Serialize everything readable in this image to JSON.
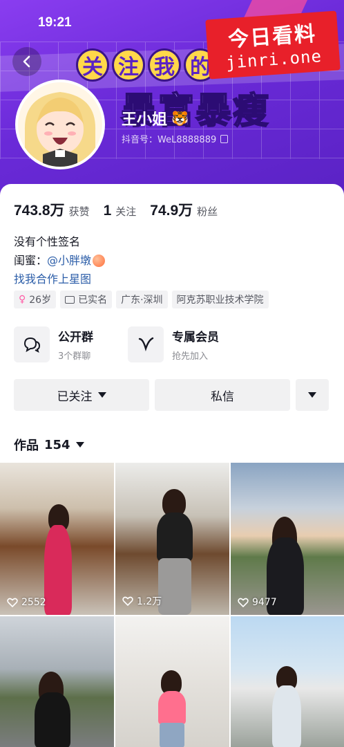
{
  "status_bar": {
    "time": "19:21"
  },
  "banner": {
    "headline_chars": [
      "关",
      "注",
      "我",
      "的"
    ],
    "subtitle": "暴富暴瘦",
    "watermark_top": "今日看料",
    "watermark_bottom": "jinri.one"
  },
  "profile": {
    "name": "王小姐",
    "name_emoji": "🐯",
    "douyin_id": "抖音号：WeL8888889",
    "stats": [
      {
        "value": "743.8万",
        "label": "获赞"
      },
      {
        "value": "1",
        "label": "关注"
      },
      {
        "value": "74.9万",
        "label": "粉丝"
      }
    ],
    "signature": "没有个性签名",
    "bestie_label": "闺蜜：",
    "bestie_mention": "@小胖墩",
    "collab_link": "找我合作上星图",
    "tags": {
      "age": "26岁",
      "verified": "已实名",
      "location": "广东·深圳",
      "school": "阿克苏职业技术学院"
    }
  },
  "features": [
    {
      "title": "公开群",
      "subtitle": "3个群聊",
      "icon": "group-chat-icon"
    },
    {
      "title": "专属会员",
      "subtitle": "抢先加入",
      "icon": "membership-icon"
    }
  ],
  "actions": {
    "follow_label": "已关注",
    "message_label": "私信"
  },
  "works": {
    "label": "作品",
    "count": "154"
  },
  "videos": [
    {
      "likes": "2552"
    },
    {
      "likes": "1.2万"
    },
    {
      "likes": "9477"
    },
    {
      "likes": ""
    },
    {
      "likes": ""
    },
    {
      "likes": ""
    }
  ]
}
